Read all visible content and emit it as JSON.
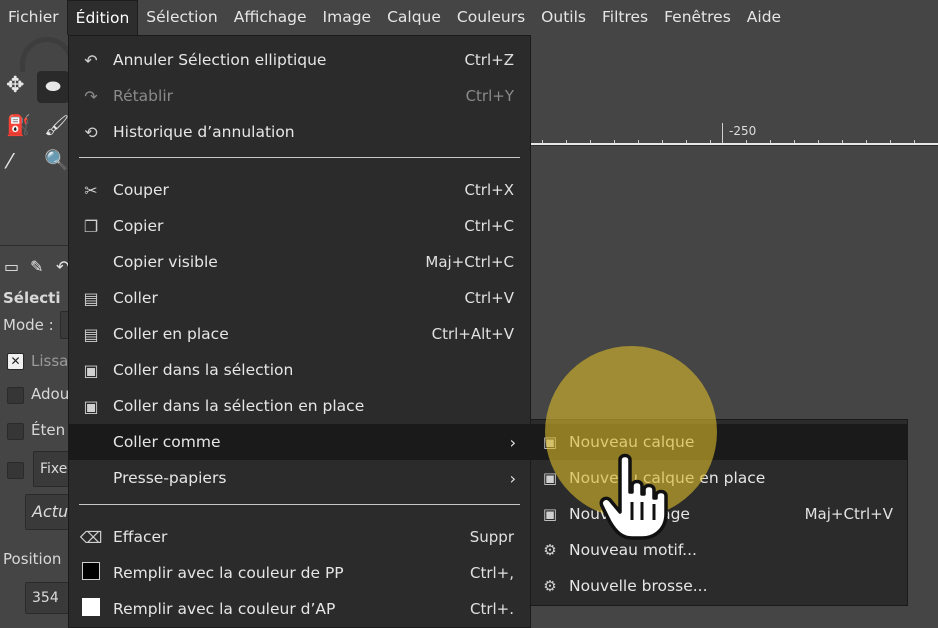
{
  "menubar": {
    "items": [
      "Fichier",
      "Édition",
      "Sélection",
      "Affichage",
      "Image",
      "Calque",
      "Couleurs",
      "Outils",
      "Filtres",
      "Fenêtres",
      "Aide"
    ],
    "active": "Édition"
  },
  "ruler": {
    "label": "-250"
  },
  "tool_options": {
    "title": "Sélecti",
    "mode_label": "Mode :",
    "antialias": "Lissa",
    "feather": "Adou",
    "expand": "Éten",
    "fixed": "Fixe",
    "current": "Actu",
    "position_label": "Position",
    "position_value": "354"
  },
  "edit_menu": {
    "items": [
      {
        "icon": "undo-icon",
        "glyph": "↶",
        "label": "Annuler Sélection elliptique",
        "shortcut": "Ctrl+Z",
        "enabled": true
      },
      {
        "icon": "redo-icon",
        "glyph": "↷",
        "label": "Rétablir",
        "shortcut": "Ctrl+Y",
        "enabled": false
      },
      {
        "icon": "undo-history-icon",
        "glyph": "⟲",
        "label": "Historique d’annulation",
        "shortcut": "",
        "enabled": true
      },
      {
        "icon": "scissors-icon",
        "glyph": "✂",
        "label": "Couper",
        "shortcut": "Ctrl+X",
        "enabled": true
      },
      {
        "icon": "copy-icon",
        "glyph": "❐",
        "label": "Copier",
        "shortcut": "Ctrl+C",
        "enabled": true
      },
      {
        "icon": "",
        "glyph": "",
        "label": "Copier visible",
        "shortcut": "Maj+Ctrl+C",
        "enabled": true
      },
      {
        "icon": "paste-icon",
        "glyph": "📋",
        "label": "Coller",
        "shortcut": "Ctrl+V",
        "enabled": true
      },
      {
        "icon": "paste-in-place-icon",
        "glyph": "📋",
        "label": "Coller en place",
        "shortcut": "Ctrl+Alt+V",
        "enabled": true
      },
      {
        "icon": "paste-into-icon",
        "glyph": "▣",
        "label": "Coller dans la sélection",
        "shortcut": "",
        "enabled": true
      },
      {
        "icon": "paste-into-in-place-icon",
        "glyph": "▣",
        "label": "Coller dans la sélection en place",
        "shortcut": "",
        "enabled": true
      },
      {
        "icon": "",
        "glyph": "",
        "label": "Coller comme",
        "shortcut": "",
        "enabled": true,
        "submenu": true
      },
      {
        "icon": "",
        "glyph": "",
        "label": "Presse-papiers",
        "shortcut": "",
        "enabled": true,
        "submenu": true
      },
      {
        "icon": "clear-icon",
        "glyph": "⌫",
        "label": "Effacer",
        "shortcut": "Suppr",
        "enabled": true
      },
      {
        "icon": "fill-fg-icon",
        "glyph": "",
        "label": "Remplir avec la couleur de PP",
        "shortcut": "Ctrl+,",
        "enabled": true
      },
      {
        "icon": "fill-bg-icon",
        "glyph": "",
        "label": "Remplir avec la couleur d’AP",
        "shortcut": "Ctrl+.",
        "enabled": true
      }
    ]
  },
  "paste_as_submenu": {
    "items": [
      {
        "icon": "new-layer-icon",
        "glyph": "▣",
        "label": "Nouveau calque",
        "shortcut": ""
      },
      {
        "icon": "new-layer-in-place-icon",
        "glyph": "▣",
        "label": "Nouveau calque en place",
        "shortcut": ""
      },
      {
        "icon": "new-image-icon",
        "glyph": "▣",
        "label": "Nouvelle image",
        "shortcut": "Maj+Ctrl+V"
      },
      {
        "icon": "new-pattern-icon",
        "glyph": "⚙",
        "label": "Nouveau motif...",
        "shortcut": ""
      },
      {
        "icon": "new-brush-icon",
        "glyph": "⚙",
        "label": "Nouvelle brosse...",
        "shortcut": ""
      }
    ]
  },
  "colors": {
    "menu_bg": "#2b2b2b",
    "highlight_bg": "#1a1a1a",
    "ui_bg": "#454545",
    "spotlight": "#d6b82c",
    "fill_fg_swatch": "#000000",
    "fill_bg_swatch": "#ffffff"
  }
}
